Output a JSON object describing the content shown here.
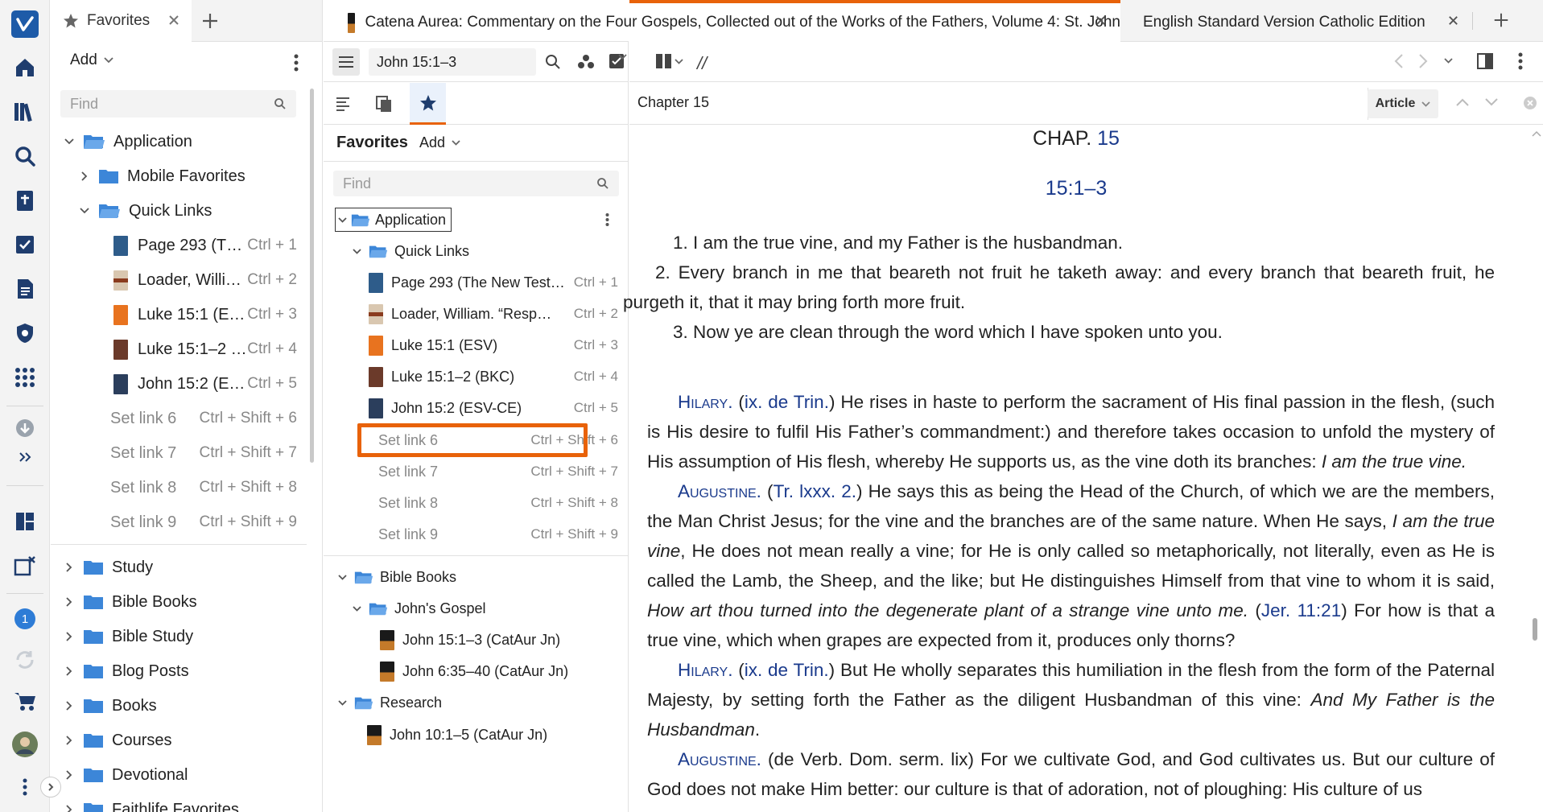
{
  "rail": {
    "badge_count": "1"
  },
  "favorites_panel": {
    "tab_label": "Favorites",
    "add_label": "Add",
    "find_placeholder": "Find",
    "tree": {
      "application": "Application",
      "mobile_favorites": "Mobile Favorites",
      "quick_links": "Quick Links",
      "links": [
        {
          "label": "Page 293 (T…",
          "shortcut": "Ctrl + 1"
        },
        {
          "label": "Loader, Willi…",
          "shortcut": "Ctrl + 2"
        },
        {
          "label": "Luke 15:1 (E…",
          "shortcut": "Ctrl + 3"
        },
        {
          "label": "Luke 15:1–2 …",
          "shortcut": "Ctrl + 4"
        },
        {
          "label": "John 15:2 (E…",
          "shortcut": "Ctrl + 5"
        }
      ],
      "set_links": [
        {
          "label": "Set link 6",
          "shortcut": "Ctrl + Shift + 6"
        },
        {
          "label": "Set link 7",
          "shortcut": "Ctrl + Shift + 7"
        },
        {
          "label": "Set link 8",
          "shortcut": "Ctrl + Shift + 8"
        },
        {
          "label": "Set link 9",
          "shortcut": "Ctrl + Shift + 9"
        }
      ],
      "folders": [
        "Study",
        "Bible Books",
        "Bible Study",
        "Blog Posts",
        "Books",
        "Courses",
        "Devotional",
        "Faithlife Favorites"
      ]
    }
  },
  "doc_tabs": {
    "tab1": "Catena Aurea: Commentary on the Four Gospels, Collected out of the Works of the Fathers, Volume 4: St. John",
    "tab2": "English Standard Version Catholic Edition"
  },
  "doc_toolbar": {
    "reference": "John 15:1–3"
  },
  "middle_panel": {
    "title": "Favorites",
    "add_label": "Add",
    "find_placeholder": "Find",
    "application": "Application",
    "quick_links": "Quick Links",
    "links": [
      {
        "label": "Page 293 (The New Test…",
        "shortcut": "Ctrl + 1"
      },
      {
        "label": "Loader, William. “Resp…",
        "shortcut": "Ctrl + 2"
      },
      {
        "label": "Luke 15:1 (ESV)",
        "shortcut": "Ctrl + 3"
      },
      {
        "label": "Luke 15:1–2 (BKC)",
        "shortcut": "Ctrl + 4"
      },
      {
        "label": "John 15:2 (ESV-CE)",
        "shortcut": "Ctrl + 5"
      }
    ],
    "set_links": [
      {
        "label": "Set link 6",
        "shortcut": "Ctrl + Shift + 6"
      },
      {
        "label": "Set link 7",
        "shortcut": "Ctrl + Shift + 7"
      },
      {
        "label": "Set link 8",
        "shortcut": "Ctrl + Shift + 8"
      },
      {
        "label": "Set link 9",
        "shortcut": "Ctrl + Shift + 9"
      }
    ],
    "bible_books": "Bible Books",
    "johns_gospel": "John's Gospel",
    "jg_items": [
      "John 15:1–3 (CatAur Jn)",
      "John 6:35–40 (CatAur Jn)"
    ],
    "research": "Research",
    "research_items": [
      "John 10:1–5 (CatAur Jn)"
    ]
  },
  "document": {
    "chapter_label": "Chapter 15",
    "article_label": "Article",
    "chap_heading_prefix": "CHAP.",
    "chap_number": "15",
    "range_heading": "15:1–3",
    "verses": [
      "1. I am the true vine, and my Father is the husbandman.",
      "2. Every branch in me that beareth not fruit he taketh away: and every branch that beareth fruit, he purgeth it, that it may bring forth more fruit.",
      "3. Now ye are clean through the word which I have spoken unto you."
    ],
    "p1": {
      "author": "Hilary.",
      "ref": "ix. de Trin.",
      "text": " He rises in haste to perform the sacrament of His final passion in the flesh, (such is His desire to fulfil His Father’s commandment:) and therefore takes occasion to unfold the mystery of His assumption of His flesh, whereby He supports us, as the vine doth its branches: ",
      "italic": "I am the true vine."
    },
    "p2": {
      "author": "Augustine.",
      "ref": "Tr. lxxx. 2.",
      "text_a": " He says this as being the Head of the Church, of which we are the members, the Man Christ Jesus; for the vine and the branches are of the same nature. When He says, ",
      "italic_a": "I am the true vine",
      "text_b": ", He does not mean really a vine; for He is only called so metaphorically, not literally, even as He is called the Lamb, the Sheep, and the like; but He distinguishes Himself from that vine to whom it is said, ",
      "italic_b": "How art thou turned into the degenerate plant of a strange vine unto me.",
      "ref2": "Jer. 11:21",
      "text_c": " For how is that a true vine, which when grapes are expected from it, produces only thorns?"
    },
    "p3": {
      "author": "Hilary.",
      "ref": "ix. de Trin.",
      "text": " But He wholly separates this humiliation in the flesh from the form of the Paternal Majesty, by setting forth the Father as the diligent Husbandman of this vine: ",
      "italic": "And My Father is the Husbandman",
      "end": "."
    },
    "p4": {
      "author": "Augustine.",
      "text": " (de Verb. Dom. serm. lix) For we cultivate God, and God cultivates us. But our culture of God does not make Him better: our culture is that of adoration, not of ploughing: His culture of us"
    }
  },
  "colors": {
    "accent_orange": "#e8620a",
    "folder_blue": "#4a90e2",
    "link_blue": "#1a3a8c",
    "logo_blue": "#1e5ba8"
  }
}
